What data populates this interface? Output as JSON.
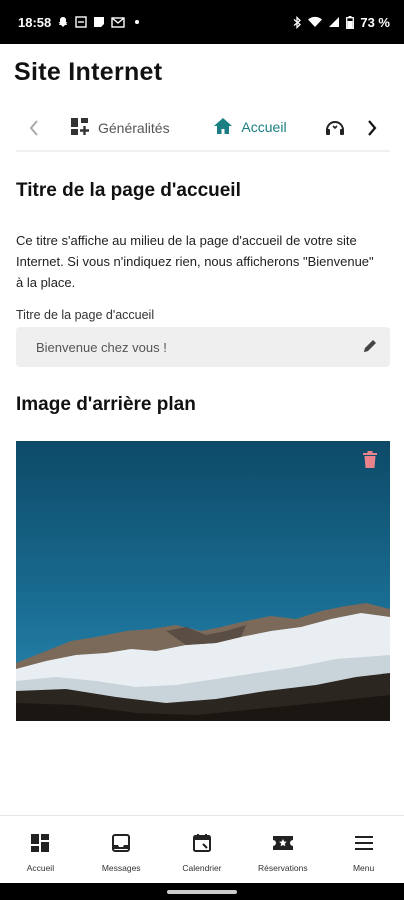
{
  "status_bar": {
    "time": "18:58",
    "battery": "73 %",
    "icons": [
      "snapchat-icon",
      "notes-icon",
      "docs-icon",
      "gmail-icon",
      "bluetooth-icon",
      "wifi-icon",
      "signal-icon",
      "battery-icon"
    ]
  },
  "header": {
    "title": "Site Internet"
  },
  "tabs": [
    {
      "label": "Généralités",
      "icon": "dashboard-icon",
      "active": false
    },
    {
      "label": "Accueil",
      "icon": "home-icon",
      "active": true
    },
    {
      "label": "",
      "icon": "support-icon",
      "active": false
    }
  ],
  "home_title_section": {
    "title": "Titre de la page d'accueil",
    "description": "Ce titre s'affiche au milieu de la page d'accueil de votre site Internet. Si vous n'indiquez rien, nous afficherons \"Bienvenue\" à la place.",
    "field_label": "Titre de la page d'accueil",
    "field_value": "Bienvenue chez vous !"
  },
  "background_section": {
    "title": "Image d'arrière plan"
  },
  "bottom_nav": [
    {
      "label": "Accueil",
      "icon": "dashboard-icon"
    },
    {
      "label": "Messages",
      "icon": "inbox-icon"
    },
    {
      "label": "Calendrier",
      "icon": "calendar-icon"
    },
    {
      "label": "Réservations",
      "icon": "ticket-icon"
    },
    {
      "label": "Menu",
      "icon": "menu-icon"
    }
  ],
  "colors": {
    "accent": "#1a7e83",
    "trash": "#e8838c",
    "field_bg": "#efefef",
    "sky": "#135a7a"
  }
}
